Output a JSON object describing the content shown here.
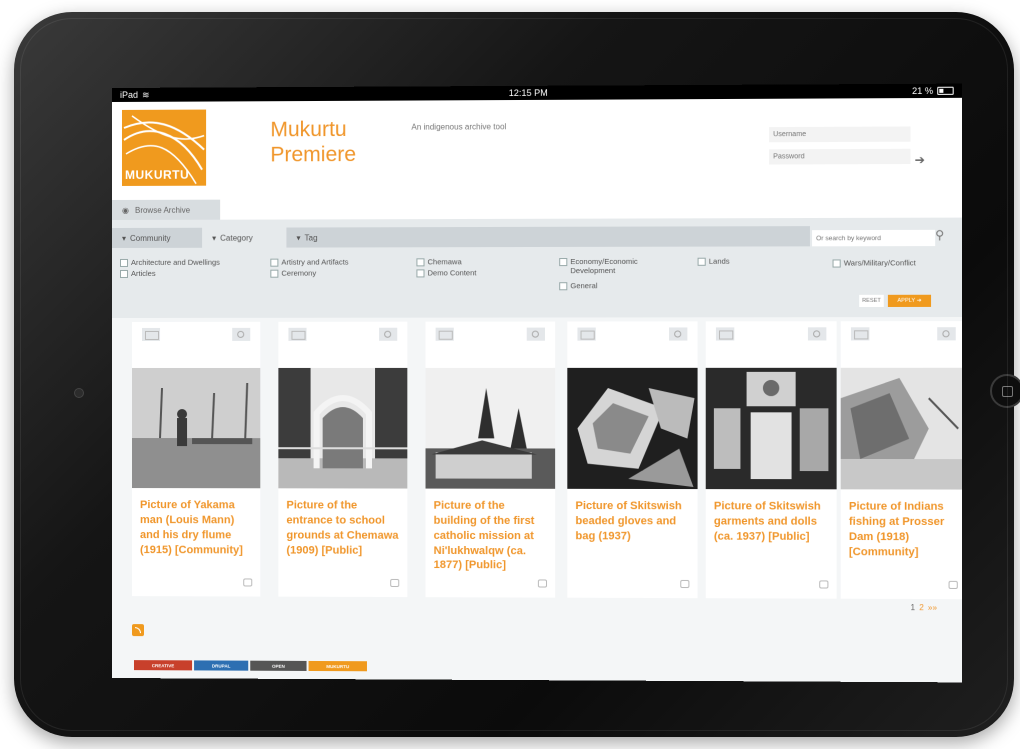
{
  "status_bar": {
    "device": "iPad",
    "time": "12:15 PM",
    "battery": "21 %"
  },
  "brand": {
    "logo_text": "MUKURTU",
    "site_name": "Mukurtu Premiere",
    "slogan": "An indigenous archive tool",
    "accent": "#f0962b"
  },
  "login": {
    "username_placeholder": "Username",
    "password_placeholder": "Password"
  },
  "browse_tab": {
    "label": "Browse Archive"
  },
  "facet_tabs": [
    {
      "label": "Community"
    },
    {
      "label": "Category"
    },
    {
      "label": "Tag"
    }
  ],
  "keyword_search": {
    "placeholder": "Or search by keyword"
  },
  "facet_options": [
    {
      "label": "Architecture and Dwellings"
    },
    {
      "label": "Articles"
    },
    {
      "label": "Artistry and Artifacts"
    },
    {
      "label": "Ceremony"
    },
    {
      "label": "Chemawa"
    },
    {
      "label": "Demo Content"
    },
    {
      "label": "Economy/Economic Development"
    },
    {
      "label": "General"
    },
    {
      "label": "Lands"
    },
    {
      "label": "Wars/Military/Conflict"
    }
  ],
  "filter_actions": {
    "reset": "RESET",
    "apply": "APPLY"
  },
  "cards": [
    {
      "title": "Picture of Yakama man (Louis Mann) and his dry flume (1915) [Community]"
    },
    {
      "title": "Picture of the entrance to school grounds at Chemawa (1909) [Public]"
    },
    {
      "title": "Picture of the building of the first catholic mission at Ni'lukhwalqw (ca. 1877) [Public]"
    },
    {
      "title": "Picture of Skitswish beaded gloves and bag (1937)"
    },
    {
      "title": "Picture of Skitswish garments and dolls (ca. 1937) [Public]"
    },
    {
      "title": "Picture of Indians fishing at Prosser Dam (1918) [Community]"
    }
  ],
  "pager": {
    "current": "1",
    "next": "2",
    "last": "»»"
  },
  "footer_badges": [
    {
      "label": "CREATIVE"
    },
    {
      "label": "DRUPAL"
    },
    {
      "label": "OPEN"
    },
    {
      "label": "MUKURTU"
    }
  ]
}
